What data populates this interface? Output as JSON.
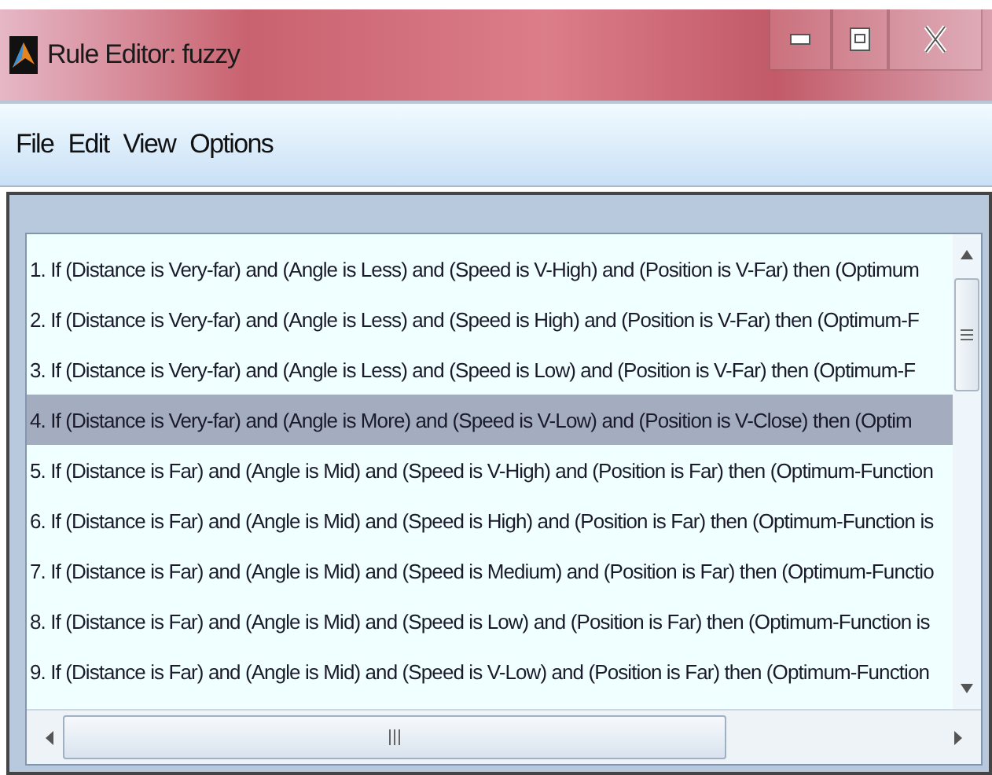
{
  "window": {
    "title": "Rule Editor: fuzzy"
  },
  "menu": [
    "File",
    "Edit",
    "View",
    "Options"
  ],
  "rules": [
    {
      "text": "1. If (Distance is Very-far) and (Angle is Less) and (Speed is V-High) and (Position is V-Far) then (Optimum",
      "selected": false
    },
    {
      "text": "2. If (Distance is Very-far) and (Angle is Less) and (Speed is High) and (Position is V-Far) then (Optimum-F",
      "selected": false
    },
    {
      "text": "3. If (Distance is Very-far) and (Angle is Less) and (Speed is Low) and (Position is V-Far) then (Optimum-F",
      "selected": false
    },
    {
      "text": "4. If (Distance is Very-far) and (Angle is More) and (Speed is V-Low) and (Position is V-Close) then (Optim",
      "selected": true
    },
    {
      "text": "5. If (Distance is Far) and (Angle is Mid) and (Speed is V-High) and (Position is Far) then (Optimum-Function",
      "selected": false
    },
    {
      "text": "6. If (Distance is Far) and (Angle is Mid) and (Speed is High) and (Position is Far) then (Optimum-Function is",
      "selected": false
    },
    {
      "text": "7. If (Distance is Far) and (Angle is Mid) and (Speed is Medium) and (Position is Far) then (Optimum-Functio",
      "selected": false
    },
    {
      "text": "8. If (Distance is Far) and (Angle is Mid) and (Speed is Low) and (Position is Far) then (Optimum-Function is",
      "selected": false
    },
    {
      "text": "9. If (Distance is Far) and (Angle is Mid) and (Speed is V-Low) and (Position is Far) then (Optimum-Function",
      "selected": false
    }
  ]
}
